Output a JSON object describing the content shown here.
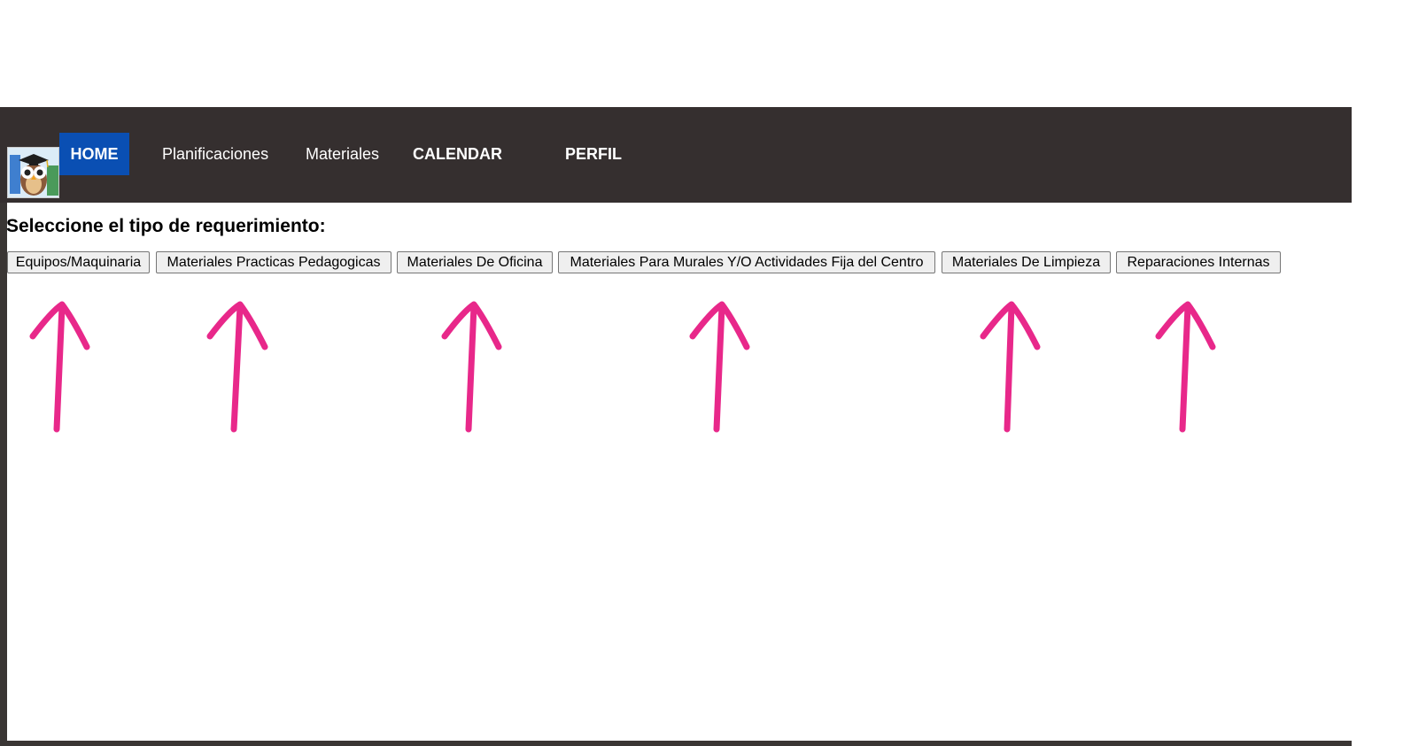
{
  "nav": {
    "home": "HOME",
    "planificaciones": "Planificaciones",
    "materiales": "Materiales",
    "calendar": "CALENDAR",
    "perfil": "PERFIL"
  },
  "main": {
    "prompt": "Seleccione el tipo de requerimiento:",
    "buttons": [
      "Equipos/Maquinaria",
      "Materiales Practicas Pedagogicas",
      "Materiales De Oficina",
      "Materiales Para Murales Y/O Actividades Fija del Centro",
      "Materiales De Limpieza",
      "Reparaciones Internas"
    ]
  },
  "colors": {
    "navbar": "#352f2f",
    "active_nav": "#0a4fb3",
    "annotation_arrows": "#e8288a"
  },
  "icons": {
    "logo": "owl-graduate-logo"
  }
}
